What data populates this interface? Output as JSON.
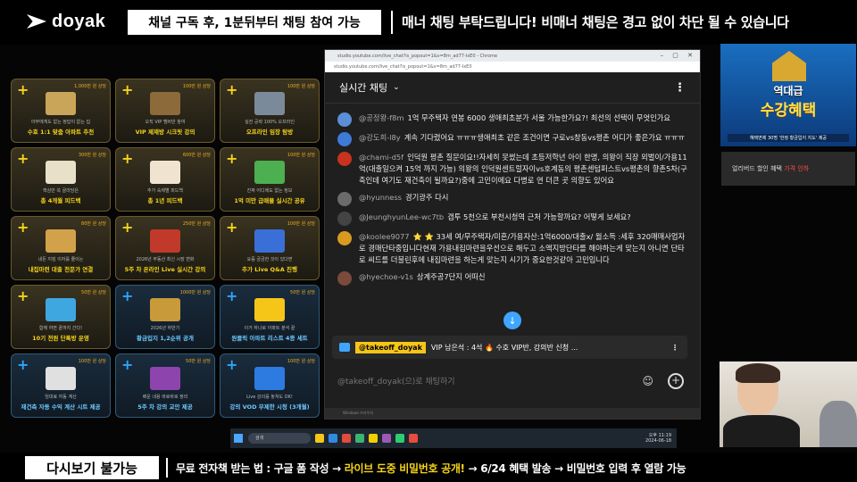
{
  "header": {
    "logo_text": "doyak",
    "subscribe_notice": "채널 구독 후, 1분뒤부터 채팅 참여 가능",
    "manner_notice": "매너 채팅 부탁드립니다! 비매너 채팅은 경고 없이 차단 될 수 있습니다"
  },
  "grid": {
    "cards": [
      {
        "price": "1,000만 원 상당",
        "sub": "아무에게도 없는 정답이 없는 집",
        "title": "수호 1:1 맞춤 아파트 추천",
        "style": "gold"
      },
      {
        "price": "100만 원 상당",
        "sub": "오직 VIP 멤버만 참여",
        "title": "VIP 제재방 시크릿 강의",
        "style": "gold"
      },
      {
        "price": "100만 원 상당",
        "sub": "실전 공략 100% 오프라인",
        "title": "오프라인 임장 탐방",
        "style": "gold"
      },
      {
        "price": "300만 원 상당",
        "sub": "핵심만 쏙 골라담은",
        "title": "총 4개월 피드백",
        "style": "gold"
      },
      {
        "price": "600만 원 상당",
        "sub": "추가 숙제별 피드백",
        "title": "총 1년 피드백",
        "style": "gold"
      },
      {
        "price": "100만 원 상당",
        "sub": "진짜 어디에도 없는 정보",
        "title": "1억 미만 급매물 실시간 공유",
        "style": "gold"
      },
      {
        "price": "80만 원 상당",
        "sub": "내돈 지킴 이자를 줄이는",
        "title": "내집마련 대출 전문가 연결",
        "style": "gold"
      },
      {
        "price": "250만 원 상당",
        "sub": "2026년 부동산 최신 시장 변화",
        "title": "5주 차 온라인 Live 실시간 강의",
        "style": "gold"
      },
      {
        "price": "100만 원 상당",
        "sub": "요즘 궁금한 것이 있다면",
        "title": "추가 Live Q&A 진행",
        "style": "gold"
      },
      {
        "price": "50만 원 상당",
        "sub": "함께 하면 끝까지 간다!",
        "title": "10기 전원 단톡방 운영",
        "style": "gold"
      },
      {
        "price": "1000만 원 상당",
        "sub": "2026년 하반기",
        "title": "황금입지 1,2순위 공개",
        "style": "blue"
      },
      {
        "price": "50만 원 상당",
        "sub": "이거 하나로 아파트 분석 끝",
        "title": "원클릭 아파트 리스트 4종 세트",
        "style": "blue"
      },
      {
        "price": "100만 원 상당",
        "sub": "임대료 자동 계산",
        "title": "재건축 자동 수익 계산 시트 제공",
        "style": "blue"
      },
      {
        "price": "50만 원 상당",
        "sub": "배운 내용 바로바로 정리",
        "title": "5주 차 강의 교안 제공",
        "style": "blue"
      },
      {
        "price": "100만 원 상당",
        "sub": "Live 강의를 놓쳐도 OK!",
        "title": "강의 VOD 무제한 시청 (3개월)",
        "style": "blue"
      }
    ]
  },
  "browser": {
    "tab_title": "studio.youtube.com/live_chat?is_popout=1&v=8m_ad77-IxE0 - Chrome",
    "url": "studio.youtube.com/live_chat?is_popout=1&v=8m_ad77-IxE0"
  },
  "chat": {
    "header_title": "실시간 채팅",
    "messages": [
      {
        "user": "@공정왕-f8m",
        "text": "1억 무주택자 연봉 6000 생애최초분가 서울 가능한가요?! 최선의 선택이 무엇인가요",
        "avatar_color": "#5a8fd8"
      },
      {
        "user": "@강도희-l8y",
        "text": "계속 기다렸어요 ㅠㅠㅠ생애최초 같은 조건이면 구로vs창동vs평촌 어디가 좋은가요 ㅠㅠㅠ",
        "avatar_color": "#3f7ad6"
      },
      {
        "user": "@chami-d5f",
        "text": "인덕원 평촌 질문이요!!자세히 못썼는데 초등저학년 아이 한명, 의왕이 직장 외벌이/가용11억(대출일으켜 15억 까지 가능) 의왕의 인덕원센트럴자이vs호계동의 평촌센텀퍼스트vs평촌의 향촌5차(구축인데 여기도 재건축이 될까요?)중에 고민이에요 다병로 연 더큰 곳 의향도 있어요",
        "avatar_color": "#c8321e"
      },
      {
        "user": "@hyunness",
        "text": "경기광주 다시",
        "avatar_color": "#6b6b6b"
      },
      {
        "user": "@JeunghyunLee-wc7tb",
        "text": "갭투 5천으로 부천시청역 근처 가능할까요? 어떻게 보세요?",
        "avatar_color": "#444444"
      },
      {
        "user": "@koolee9077",
        "text": "⭐ ⭐ 33세 여/무주택자/미혼/가용자산:1억6000/대출x/ 월소득 :세후 320매매사업자로 경매단타중입니다현재 가용내집마련을우선으로 해두고 소액지방단타를 해야하는게 맞는지 아니면 단타로 씨드를 더불린후에 내집마련을 하는게 맞는지 시기가 중요한것같아 고민입니다",
        "avatar_color": "#d89a20"
      },
      {
        "user": "@hyechoe-v1s",
        "text": "상계주공7단지 어떠신",
        "avatar_color": "#7a4a3a"
      }
    ],
    "pinned": {
      "tag": "@takeoff_doyak",
      "text": "VIP 남은석 : 4석 🔥 수호 VIP반, 강의반 신청 ..."
    },
    "input_placeholder": "@takeoff_doyak(으)로 채팅하기",
    "window_status": "Windows 브라우저"
  },
  "taskbar": {
    "search_placeholder": "검색",
    "time": "오후 11:19",
    "date": "2024-06-18"
  },
  "promo": {
    "line1": "역대급",
    "line2": "수강혜택",
    "line3": "혜택면제 30명 '한정 황금입지 지도' 제공"
  },
  "early_bird": {
    "text": "얼리버드 할인 혜택",
    "highlight": "가격 인하"
  },
  "bottom": {
    "box": "다시보기 불가능",
    "notice_a": "무료 전자책 받는 법 : 구글 폼 작성 → ",
    "notice_b": "라이브 도중 비밀번호 공개!",
    "notice_c": " → 6/24 혜택 발송 → 비밀번호 입력 후 열람 가능"
  },
  "colors": {
    "accent_gold": "#f5d31a",
    "accent_blue": "#3ea6ff",
    "chat_bg": "#1f1f1f"
  }
}
